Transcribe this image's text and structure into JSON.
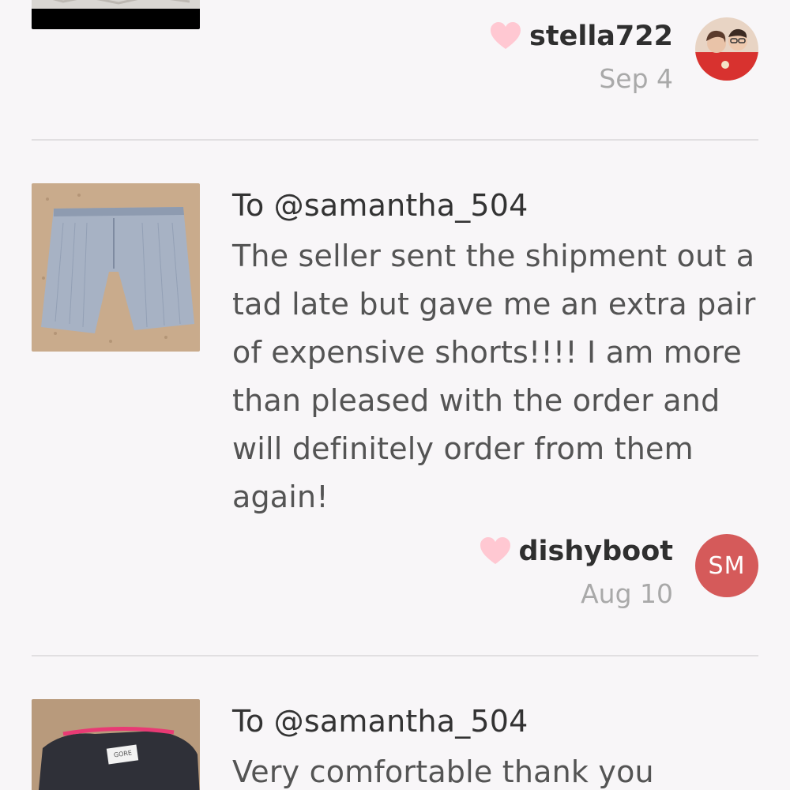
{
  "reviews": [
    {
      "username": "stella722",
      "date": "Sep 4"
    },
    {
      "recipient": "To @samantha_504",
      "text": "The seller sent the shipment out a tad late but gave me an extra pair of expensive shorts!!!! I am more than pleased with the order and will definitely order from them again!",
      "username": "dishyboot",
      "date": "Aug 10",
      "avatar_initials": "SM"
    },
    {
      "recipient": "To @samantha_504",
      "text": "Very comfortable thank you"
    }
  ],
  "colors": {
    "heart": "#ffc8d2",
    "avatar_initials_bg": "#d55a5a",
    "divider": "#e1dfe1"
  }
}
